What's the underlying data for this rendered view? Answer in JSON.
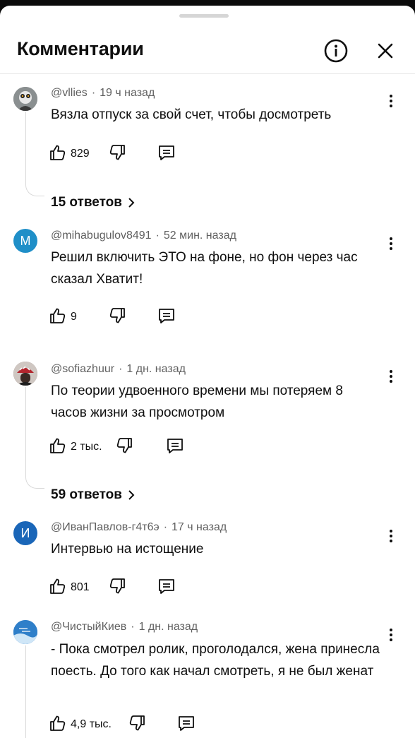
{
  "header": {
    "title": "Комментарии"
  },
  "comments": [
    {
      "author": "@vllies",
      "time": "19 ч назад",
      "text": "Вязла отпуск за свой счет, чтобы досмотреть",
      "likes": "829",
      "replies": "15 ответов",
      "avatar_color": "#6f6f6f"
    },
    {
      "author": "@mihabugulov8491",
      "time": "52 мин. назад",
      "text": "Решил включить ЭТО на фоне, но фон через час сказал Хватит!",
      "likes": "9",
      "avatar_letter": "M",
      "avatar_color": "#1f8fc8"
    },
    {
      "author": "@sofiazhuur",
      "time": "1 дн. назад",
      "text": "По теории удвоенного времени мы потеряем 8 часов жизни за просмотром",
      "likes": "2 тыс.",
      "replies": "59 ответов",
      "avatar_color": "#6b5046"
    },
    {
      "author": "@ИванПавлов-г4т6э",
      "time": "17 ч назад",
      "text": "Интервью на истощение",
      "likes": "801",
      "avatar_letter": "И",
      "avatar_color": "#1a66b8"
    },
    {
      "author": "@ЧистыйКиев",
      "time": "1 дн. назад",
      "text": "- Пока смотрел ролик, проголодался, жена принесла поесть. До того как начал смотреть, я не был женат",
      "likes": "4,9 тыс.",
      "avatar_color": "#2f7fc9"
    }
  ],
  "icons": {
    "like": "thumb-up-icon",
    "dislike": "thumb-down-icon",
    "reply": "reply-icon",
    "more": "more-vert-icon",
    "info": "info-icon",
    "close": "close-icon",
    "chevron": "chevron-right-icon"
  }
}
